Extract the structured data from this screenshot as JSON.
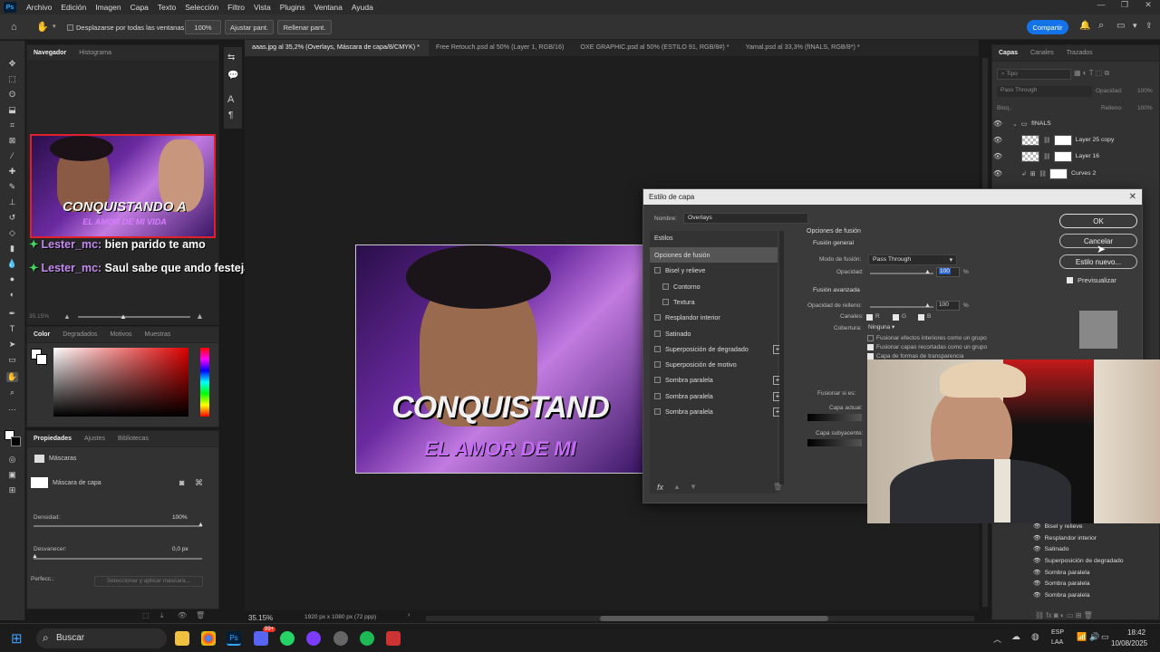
{
  "menubar": {
    "logo": "Ps",
    "items": [
      "Archivo",
      "Edición",
      "Imagen",
      "Capa",
      "Texto",
      "Selección",
      "Filtro",
      "Vista",
      "Plugins",
      "Ventana",
      "Ayuda"
    ]
  },
  "options": {
    "scroll_all_windows": "Desplazarse por todas las ventanas",
    "zoom_value": "100%",
    "fit_screen": "Ajustar pant.",
    "fill_screen": "Rellenar pant.",
    "share": "Compartir"
  },
  "navigator": {
    "tabs": [
      "Navegador",
      "Histograma"
    ],
    "thumb_title_line1": "CONQUISTANDO A",
    "thumb_title_line2": "EL AMOR DE MI VIDA",
    "zoom": "35.15%"
  },
  "chat": [
    {
      "user": "Lester_mc:",
      "message": "bien parido te amo"
    },
    {
      "user": "Lester_mc:",
      "message": "Saul sabe que ando festejando"
    }
  ],
  "color_panel": {
    "tabs": [
      "Color",
      "Degradados",
      "Motivos",
      "Muestras"
    ]
  },
  "properties": {
    "tabs": [
      "Propiedades",
      "Ajustes",
      "Bibliotecas"
    ],
    "section": "Máscaras",
    "mask_label": "Máscara de capa",
    "density_label": "Densidad:",
    "density_value": "100%",
    "feather_label": "Desvanecer:",
    "feather_value": "0,0 px",
    "refine_label": "Perfecc.:",
    "select_mask_button": "Seleccionar y aplicar máscara..."
  },
  "doc_tabs": [
    "aaas.jpg al 35,2% (Overlays, Máscara de capa/8/CMYK) *",
    "Free Retouch.psd al 50% (Layer 1, RGB/16)",
    "OXE GRAPHIC.psd al 50% (ESTILO 91, RGB/8#) *",
    "Yamal.psd al 33,3% (fINALS, RGB/8*) *"
  ],
  "canvas": {
    "title_line1": "CONQUISTAND",
    "title_line2": "EL AMOR DE MI"
  },
  "status_bar": {
    "zoom": "35.15%",
    "doc_size": "1920 px x 1080 px (72 ppp)"
  },
  "dialog": {
    "title": "Estilo de capa",
    "name_label": "Nombre:",
    "name_value": "Overlays",
    "styles_header": "Estilos",
    "styles": [
      {
        "label": "Opciones de fusión",
        "checkbox": false,
        "plus": false,
        "selected": true
      },
      {
        "label": "Bisel y relieve",
        "checkbox": true,
        "plus": false
      },
      {
        "label": "Contorno",
        "checkbox": true,
        "plus": false,
        "indent": true
      },
      {
        "label": "Textura",
        "checkbox": true,
        "plus": false,
        "indent": true
      },
      {
        "label": "Resplandor interior",
        "checkbox": true,
        "plus": false
      },
      {
        "label": "Satinado",
        "checkbox": true,
        "plus": false
      },
      {
        "label": "Superposición de degradado",
        "checkbox": true,
        "plus": true
      },
      {
        "label": "Superposición de motivo",
        "checkbox": true,
        "plus": false
      },
      {
        "label": "Sombra paralela",
        "checkbox": true,
        "plus": true
      },
      {
        "label": "Sombra paralela",
        "checkbox": true,
        "plus": true
      },
      {
        "label": "Sombra paralela",
        "checkbox": true,
        "plus": true
      }
    ],
    "fx": "fx",
    "blend_header": "Opciones de fusión",
    "general_header": "Fusión general",
    "blend_mode_label": "Modo de fusión:",
    "blend_mode_value": "Pass Through",
    "opacity_label": "Opacidad:",
    "opacity_value": "100",
    "percent": "%",
    "advanced_header": "Fusión avanzada",
    "fill_opacity_label": "Opacidad de relleno:",
    "fill_opacity_value": "100",
    "channels_label": "Canales:",
    "channel_r": "R",
    "channel_g": "G",
    "channel_b": "B",
    "knockout_label": "Cobertura:",
    "knockout_value": "Ninguna",
    "opt1": "Fusionar efectos interiores como un grupo",
    "opt2": "Fusionar capas recortadas como un grupo",
    "opt3": "Capa de formas de transparencia",
    "blend_if_label": "Fusionar si es:",
    "current_layer_label": "Capa actual:",
    "underlying_label": "Capa subyacente:",
    "ok": "OK",
    "cancel": "Cancelar",
    "new_style": "Estilo nuevo...",
    "preview": "Previsualizar"
  },
  "layers": {
    "tabs": [
      "Capas",
      "Canales",
      "Trazados"
    ],
    "search_placeholder": "Tipo",
    "blend_mode": "Pass Through",
    "opacity_label": "Opacidad:",
    "opacity_value": "100%",
    "lock_label": "Bloq.:",
    "fill_label": "Relleno:",
    "fill_value": "100%",
    "rows": [
      "fINALS",
      "Layer 25 copy",
      "Layer 16",
      "Curves 2"
    ],
    "effects": [
      "Bisel y relieve",
      "Resplandor interior",
      "Satinado",
      "Superposición de degradado",
      "Sombra paralela",
      "Sombra paralela",
      "Sombra paralela"
    ]
  },
  "taskbar": {
    "search": "Buscar",
    "lang1": "ESP",
    "lang2": "LAA",
    "time": "18:42",
    "date": "10/08/2025",
    "badge": "99+"
  }
}
